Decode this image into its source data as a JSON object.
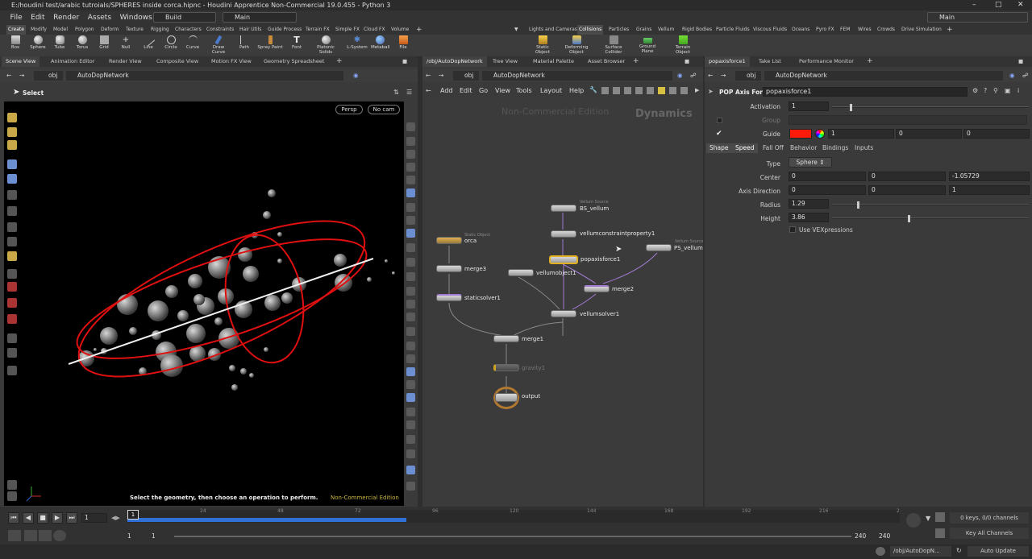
{
  "window": {
    "title": "E:/houdini test/arabic tutroials/SPHERES inside corca.hipnc - Houdini Apprentice Non-Commercial 19.0.455 - Python 3"
  },
  "menu": [
    "File",
    "Edit",
    "Render",
    "Assets",
    "Windows",
    "Help"
  ],
  "desktop_left": "Build",
  "desktop_mid": "Main",
  "desktop_right": "Main",
  "shelf_tabs_left": [
    "Create",
    "Modify",
    "Model",
    "Polygon",
    "Deform",
    "Texture",
    "Rigging",
    "Characters",
    "Constraints",
    "Hair Utils",
    "Guide Process",
    "Terrain FX",
    "Simple FX",
    "Cloud FX",
    "Volume"
  ],
  "shelf_tabs_right": [
    "Lights and Cameras",
    "Collisions",
    "Particles",
    "Grains",
    "Vellum",
    "Rigid Bodies",
    "Particle Fluids",
    "Viscous Fluids",
    "Oceans",
    "Pyro FX",
    "FEM",
    "Wires",
    "Crowds",
    "Drive Simulation"
  ],
  "shelf_tools_left": [
    "Box",
    "Sphere",
    "Tube",
    "Torus",
    "Grid",
    "Null",
    "Line",
    "Circle",
    "Curve",
    "Draw Curve",
    "Path",
    "Spray Paint",
    "Font",
    "Platonic Solids",
    "L-System",
    "Metaball",
    "File"
  ],
  "shelf_tools_right": [
    "Static Object",
    "Deforming Object",
    "Surface Collider",
    "Ground Plane",
    "Terrain Object"
  ],
  "left_pane": {
    "tabs": [
      "Scene View",
      "Animation Editor",
      "Render View",
      "Composite View",
      "Motion FX View",
      "Geometry Spreadsheet"
    ],
    "path_root": "obj",
    "path_node": "AutoDopNetwork",
    "tool": "Select",
    "persp": "Persp",
    "cam": "No cam",
    "status": "Select the geometry, then choose an operation to perform.",
    "watermark": "Non-Commercial Edition"
  },
  "mid_pane": {
    "tabs": [
      "/obj/AutoDopNetwork",
      "Tree View",
      "Material Palette",
      "Asset Browser"
    ],
    "path_root": "obj",
    "path_node": "AutoDopNetwork",
    "menu": [
      "Add",
      "Edit",
      "Go",
      "View",
      "Tools",
      "Layout",
      "Help"
    ],
    "watermark": "Non-Commercial Edition",
    "context": "Dynamics",
    "nodes": [
      {
        "name": "BS_vellum",
        "sub": "Vellum Source"
      },
      {
        "name": "vellumconstraintproperty1",
        "sub": ""
      },
      {
        "name": "popaxisforce1",
        "sub": ""
      },
      {
        "name": "PS_vellum",
        "sub": "Vellum Source"
      },
      {
        "name": "orca",
        "sub": "Static Object"
      },
      {
        "name": "merge3",
        "sub": ""
      },
      {
        "name": "vellumobject1",
        "sub": ""
      },
      {
        "name": "merge2",
        "sub": ""
      },
      {
        "name": "staticsolver1",
        "sub": ""
      },
      {
        "name": "vellumsolver1",
        "sub": ""
      },
      {
        "name": "merge1",
        "sub": ""
      },
      {
        "name": "gravity1",
        "sub": ""
      },
      {
        "name": "output",
        "sub": ""
      }
    ]
  },
  "right_pane": {
    "tabs": [
      "popaxisforce1",
      "Take List",
      "Performance Monitor"
    ],
    "path_root": "obj",
    "path_node": "AutoDopNetwork",
    "node_type": "POP Axis Force",
    "node_name": "popaxisforce1",
    "activation_label": "Activation",
    "activation": "1",
    "group_label": "Group",
    "guide_label": "Guide",
    "guide_color": "#ff1a0a",
    "guide_vals": [
      "1",
      "0",
      "0"
    ],
    "subtabs": [
      "Shape",
      "Speed",
      "Fall Off",
      "Behavior",
      "Bindings",
      "Inputs"
    ],
    "type_label": "Type",
    "type_value": "Sphere",
    "center_label": "Center",
    "center": [
      "0",
      "0",
      "-1.05729"
    ],
    "axis_label": "Axis Direction",
    "axis": [
      "0",
      "0",
      "1"
    ],
    "radius_label": "Radius",
    "radius": "1.29",
    "height_label": "Height",
    "height": "3.86",
    "vex_label": "Use VEXpressions"
  },
  "timeline": {
    "frame": "1",
    "start": "1",
    "start2": "1",
    "end": "240",
    "end2": "240",
    "ticks": [
      "1",
      "24",
      "48",
      "72",
      "96",
      "120",
      "144",
      "168",
      "192",
      "216",
      "2"
    ],
    "keys": "0 keys, 0/0 channels",
    "key_all": "Key All Channels",
    "path": "/obj/AutoDopN...",
    "update": "Auto Update"
  }
}
